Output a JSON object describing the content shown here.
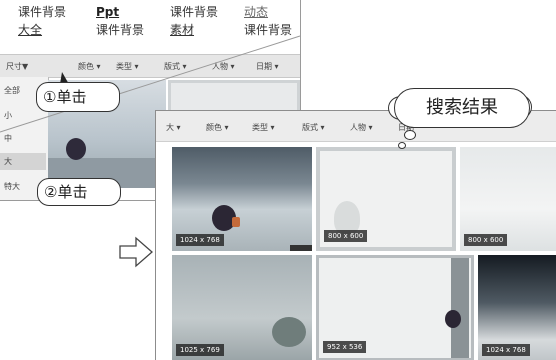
{
  "top_links": {
    "row1": [
      "课件背景",
      "Ppt",
      "课件背景",
      "动态"
    ],
    "row2": [
      "大全",
      "课件背景",
      "素材",
      "课件背景"
    ]
  },
  "back_filter_bar": {
    "items": [
      "尺寸▼",
      "颜色 ▾",
      "类型 ▾",
      "版式 ▾",
      "人物 ▾",
      "日期 ▾"
    ]
  },
  "size_menu": {
    "items": [
      "全部",
      "小",
      "中",
      "大",
      "特大"
    ],
    "selected": "大"
  },
  "front_filter_bar": {
    "items": [
      "大 ▾",
      "颜色 ▾",
      "类型 ▾",
      "版式 ▾",
      "人物 ▾",
      "日期"
    ]
  },
  "thumbnails": [
    {
      "size": "1024 x 768"
    },
    {
      "size": "800 x 600"
    },
    {
      "size": "800 x 600"
    },
    {
      "size": "1025 x 769"
    },
    {
      "size": "952 x 536"
    },
    {
      "size": "1024 x 768"
    }
  ],
  "callouts": {
    "step1": "①单击",
    "step2": "②单击",
    "result": "搜索结果"
  },
  "colors": {
    "filter_bar_bg": "#ececec",
    "callout_border": "#333333",
    "size_label_bg": "#1e1e1e"
  }
}
